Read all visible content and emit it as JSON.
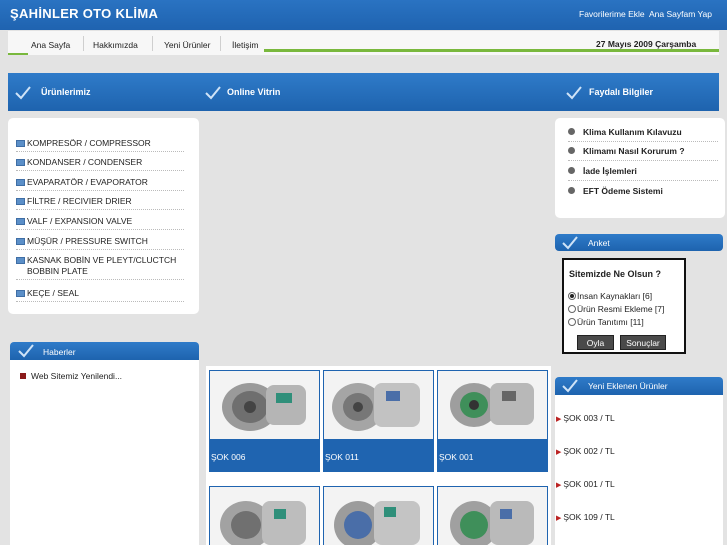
{
  "header": {
    "title": "ŞAHİNLER OTO KLİMA",
    "links": [
      "Favorilerime Ekle",
      "Ana Sayfam Yap"
    ]
  },
  "nav": {
    "items": [
      "Ana Sayfa",
      "Hakkımızda",
      "Yeni Ürünler",
      "İletişim"
    ],
    "date": "27 Mayıs 2009 Çarşamba"
  },
  "sections": {
    "products": "Ürünlerimiz",
    "showcase": "Online Vitrin",
    "info": "Faydalı Bilgiler",
    "poll": "Anket",
    "news": "Haberler",
    "new_products": "Yeni Eklenen Ürünler"
  },
  "categories": [
    "KOMPRESÖR / COMPRESSOR",
    "KONDANSER / CONDENSER",
    "EVAPARATÖR / EVAPORATOR",
    "FİLTRE / RECIVIER DRIER",
    "VALF / EXPANSION VALVE",
    "MÜŞÜR / PRESSURE SWITCH",
    "KASNAK BOBİN VE PLEYT/CLUCTCH BOBBIN PLATE",
    "KEÇE / SEAL"
  ],
  "info_links": [
    "Klima Kullanım Kılavuzu",
    "Klimamı Nasıl Korurum ?",
    "İade İşlemleri",
    "EFT Ödeme Sistemi"
  ],
  "poll": {
    "question": "Sitemizde Ne Olsun ?",
    "options": [
      "İnsan Kaynakları [6]",
      "Ürün Resmi Ekleme [7]",
      "Ürün Tanıtımı [11]"
    ],
    "selected": 0,
    "vote_label": "Oyla",
    "results_label": "Sonuçlar"
  },
  "news": {
    "items": [
      "Web Sitemiz Yenilendi..."
    ]
  },
  "showcase": {
    "products": [
      "ŞOK 006",
      "ŞOK 011",
      "ŞOK 001"
    ]
  },
  "new_products": {
    "items": [
      "ŞOK 003 / TL",
      "ŞOK 002 / TL",
      "ŞOK 001 / TL",
      "ŞOK 109 / TL"
    ]
  },
  "colors": {
    "header_blue": "#1f63b0",
    "nav_green": "#79b83d",
    "page_bg": "#e3e3e3"
  }
}
